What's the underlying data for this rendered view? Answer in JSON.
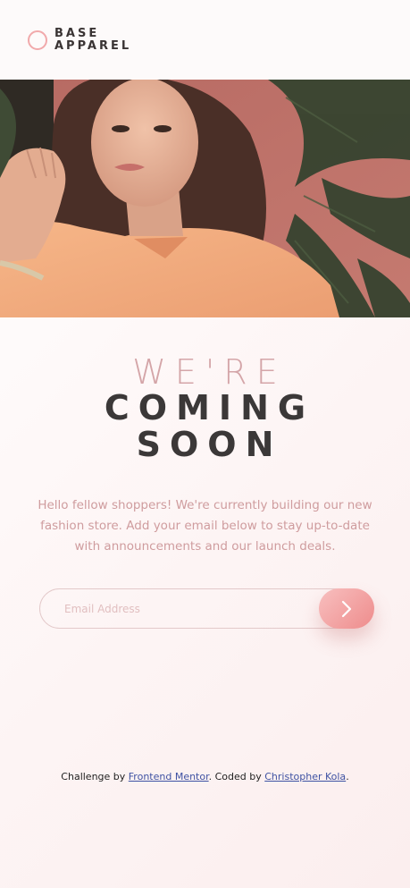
{
  "logo": {
    "line1": "BASE",
    "line2": "APPAREL"
  },
  "hero": {
    "image_icon": "woman-portrait-photo"
  },
  "headline": {
    "line1": "WE'RE",
    "line2": "COMING",
    "line3": "SOON"
  },
  "description": "Hello fellow shoppers! We're currently building our new fashion store. Add your email below to stay up-to-date with announcements and our launch deals.",
  "form": {
    "email_placeholder": "Email Address",
    "submit_icon": "chevron-right-icon"
  },
  "attribution": {
    "prefix": "Challenge by ",
    "link1": "Frontend Mentor",
    "middle": ". Coded by ",
    "link2": "Christopher Kola",
    "suffix": "."
  },
  "colors": {
    "accent": "#f1a9ab",
    "button_start": "#f8bfbf",
    "button_end": "#ee8c8c",
    "headline_light": "#d4a5a8",
    "headline_dark": "#3b3838",
    "body_text": "#cf9c9e",
    "link": "#3e52a3"
  }
}
